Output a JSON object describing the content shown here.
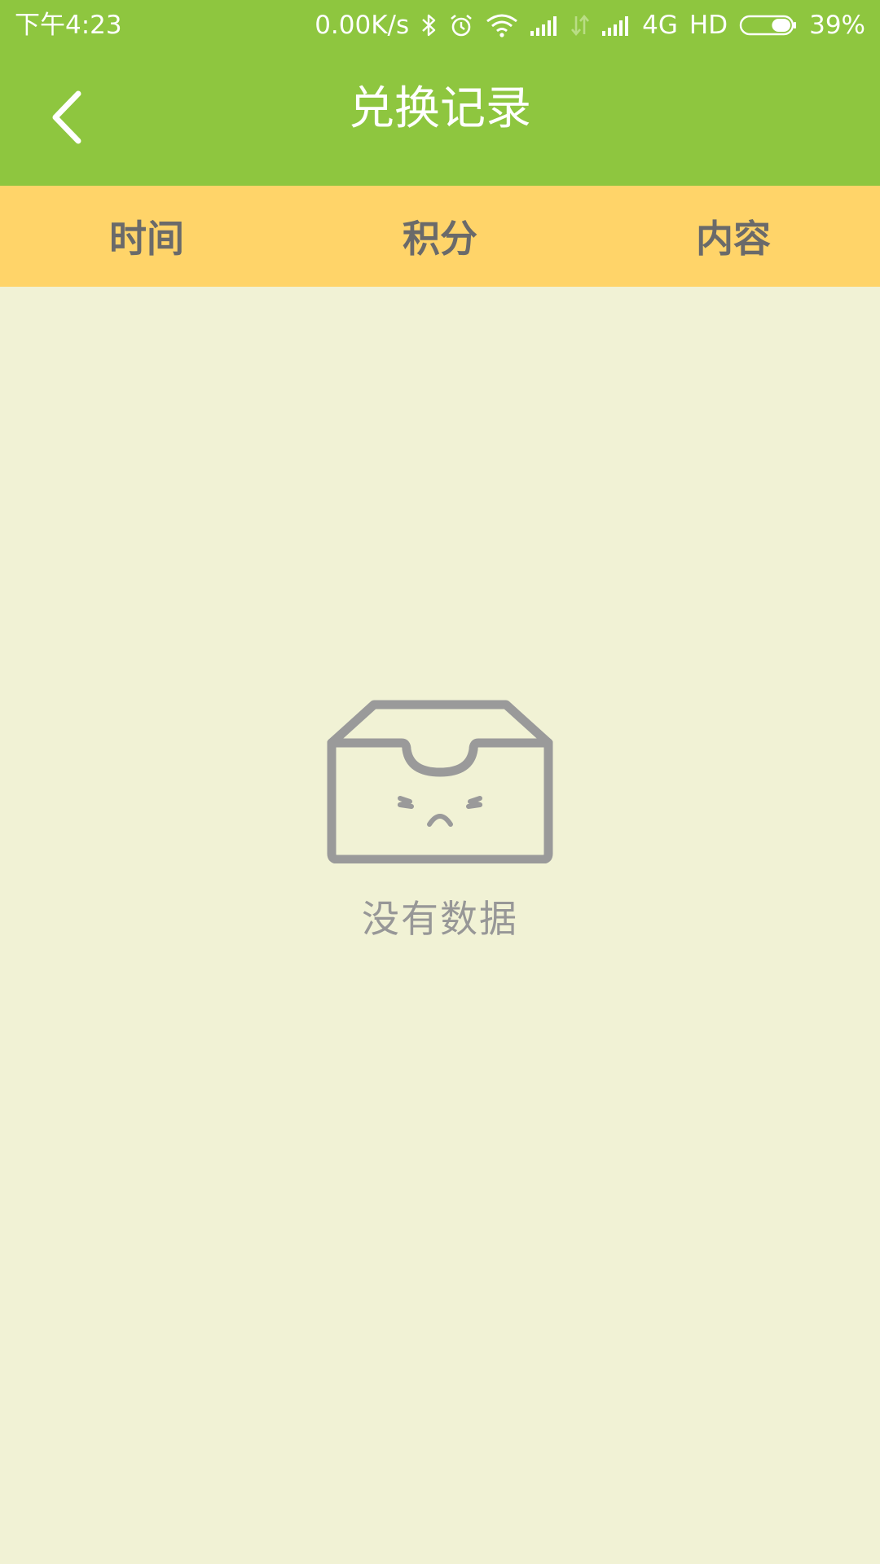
{
  "status_bar": {
    "time": "下午4:23",
    "net_speed": "0.00K/s",
    "network_type": "4G",
    "hd_label": "HD",
    "battery_percent": "39%",
    "battery_level": 0.39,
    "icons": [
      "bluetooth-icon",
      "alarm-icon",
      "wifi-icon",
      "signal-icon",
      "data-arrows-icon",
      "signal-icon",
      "battery-icon"
    ]
  },
  "header": {
    "title": "兑换记录",
    "back_icon": "chevron-left-icon"
  },
  "table": {
    "columns": [
      "时间",
      "积分",
      "内容"
    ],
    "rows": []
  },
  "empty_state": {
    "icon": "empty-box-icon",
    "text": "没有数据"
  },
  "colors": {
    "header_green": "#8EC63F",
    "table_header_yellow": "#FFD469",
    "background": "#F1F2D5",
    "header_text": "#6A6A6A",
    "empty_gray": "#979797"
  }
}
